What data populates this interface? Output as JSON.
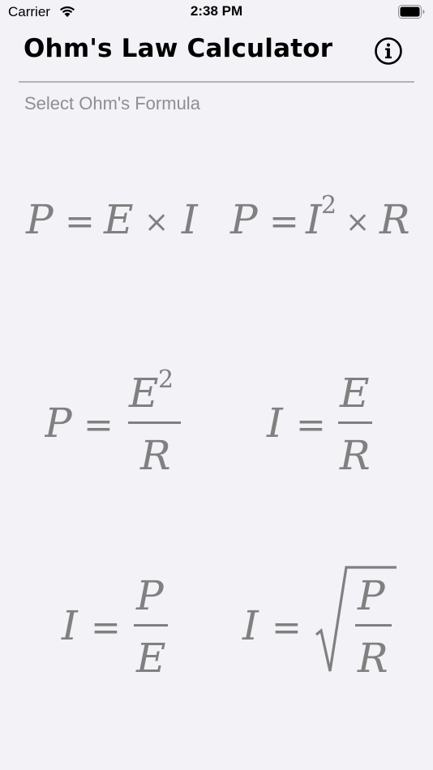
{
  "status_bar": {
    "carrier": "Carrier",
    "time": "2:38 PM"
  },
  "nav": {
    "title": "Ohm's Law Calculator",
    "info_icon": "info-circle-icon"
  },
  "section": {
    "label": "Select Ohm's Formula"
  },
  "formulas": [
    {
      "id": "p-equals-e-times-i",
      "lhs": "P",
      "text": "P = E × I"
    },
    {
      "id": "p-equals-i-squared-times-r",
      "lhs": "P",
      "text": "P = I² × R"
    },
    {
      "id": "p-equals-e-squared-over-r",
      "lhs": "P",
      "numerator": "E²",
      "denominator": "R",
      "text": "P = E²/R"
    },
    {
      "id": "i-equals-e-over-r",
      "lhs": "I",
      "numerator": "E",
      "denominator": "R",
      "text": "I = E/R"
    },
    {
      "id": "i-equals-p-over-e",
      "lhs": "I",
      "numerator": "P",
      "denominator": "E",
      "text": "I = P/E"
    },
    {
      "id": "i-equals-sqrt-p-over-r",
      "lhs": "I",
      "numerator": "P",
      "denominator": "R",
      "text": "I = √(P/R)"
    }
  ],
  "colors": {
    "background": "#f2f2f7",
    "formula_gray": "#808080",
    "label_gray": "#8e8e93",
    "divider": "#b4b4b8"
  }
}
